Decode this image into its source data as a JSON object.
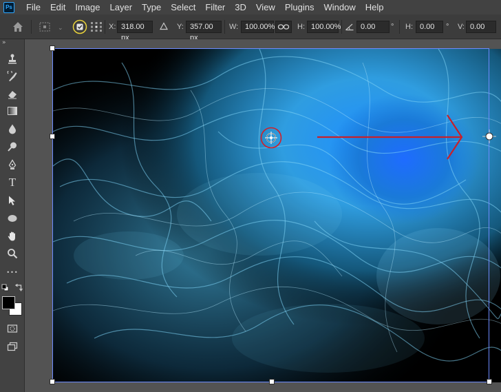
{
  "app": {
    "logo": "Ps"
  },
  "menu": [
    "File",
    "Edit",
    "Image",
    "Layer",
    "Type",
    "Select",
    "Filter",
    "3D",
    "View",
    "Plugins",
    "Window",
    "Help"
  ],
  "options": {
    "x_label": "X:",
    "x_value": "318.00 px",
    "y_label": "Y:",
    "y_value": "357.00 px",
    "w_label": "W:",
    "w_value": "100.00%",
    "h_label": "H:",
    "h_value": "100.00%",
    "angle_value": "0.00",
    "deg": "°",
    "hskew_label": "H:",
    "hskew_value": "0.00",
    "vskew_label": "V:",
    "vskew_value": "0.00"
  },
  "toolbar": {
    "collapse": "»",
    "tools": [
      "stamp-icon",
      "history-brush-icon",
      "eraser-icon",
      "gradient-icon",
      "blur-drop-icon",
      "dodge-icon",
      "pen-icon",
      "type-icon",
      "path-select-icon",
      "ellipse-icon",
      "hand-icon",
      "zoom-icon",
      "more-icon"
    ],
    "type_glyph": "T",
    "more_glyph": "•••"
  },
  "colors": {
    "foreground": "#000000",
    "background": "#ffffff",
    "annotation": "#d0202a",
    "accent": "#31a8ff"
  }
}
